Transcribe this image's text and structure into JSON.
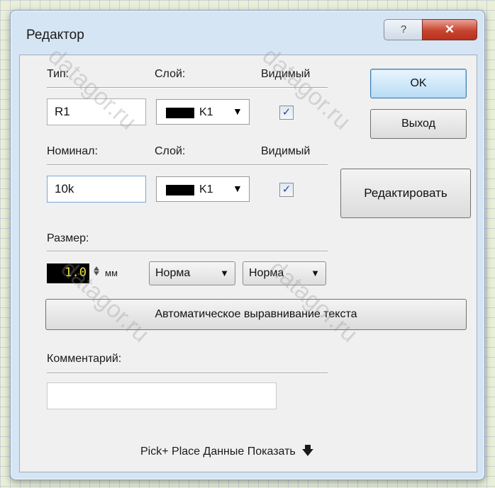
{
  "window": {
    "title": "Редактор",
    "help_glyph": "?",
    "close_glyph": "✕"
  },
  "row1": {
    "type_label": "Тип:",
    "layer_label": "Слой:",
    "visible_label": "Видимый",
    "type_value": "R1",
    "layer_value": "K1",
    "visible_checked": true
  },
  "row2": {
    "value_label": "Номинал:",
    "layer_label": "Слой:",
    "visible_label": "Видимый",
    "value_value": "10k",
    "layer_value": "K1",
    "visible_checked": true
  },
  "buttons": {
    "ok": "OK",
    "exit": "Выход",
    "edit": "Редактировать",
    "auto_align": "Автоматическое выравнивание текста"
  },
  "size": {
    "label": "Размер:",
    "value": "1.0",
    "unit": "мм",
    "style1": "Норма",
    "style2": "Норма"
  },
  "comment": {
    "label": "Комментарий:",
    "value": ""
  },
  "footer": {
    "text": "Pick+ Place Данные Показать",
    "arrow": "🡇"
  },
  "watermark": "datagor.ru",
  "icons": {
    "layer_dropdown": "triangle-down",
    "checkbox": "checkmark",
    "spinner": "up-down-arrows",
    "footer": "arrow-down"
  },
  "colors": {
    "lcd_text": "#f6e23a",
    "close_button": "#c8442f",
    "ok_button": "#b8dcf5"
  }
}
